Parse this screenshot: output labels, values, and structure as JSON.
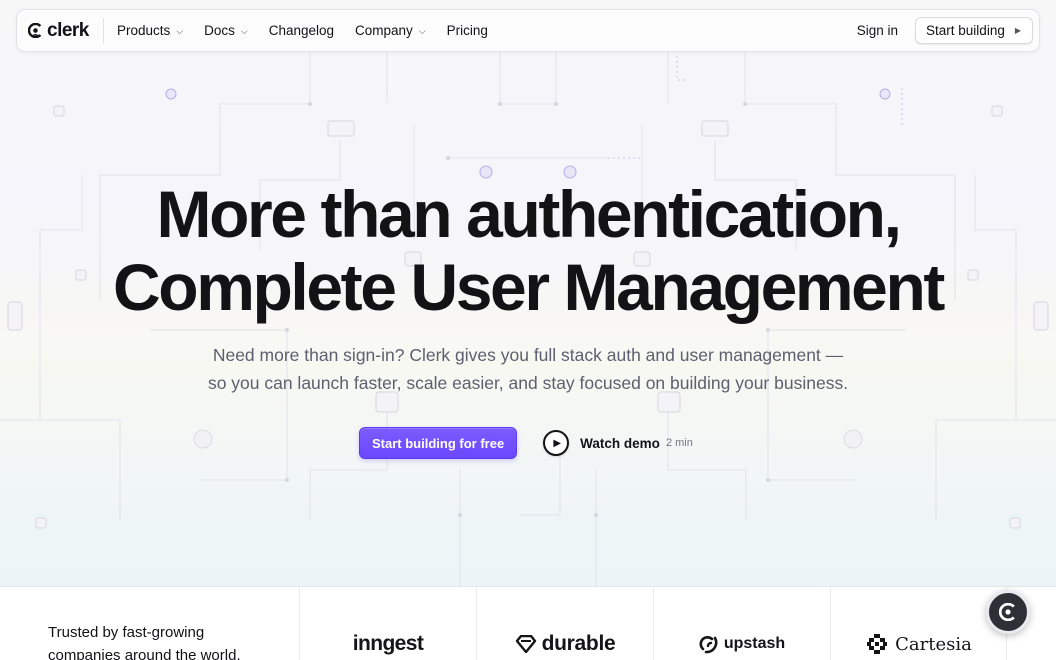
{
  "nav": {
    "logo_text": "clerk",
    "items": [
      {
        "label": "Products",
        "dropdown": true
      },
      {
        "label": "Docs",
        "dropdown": true
      },
      {
        "label": "Changelog",
        "dropdown": false
      },
      {
        "label": "Company",
        "dropdown": true
      },
      {
        "label": "Pricing",
        "dropdown": false
      }
    ],
    "signin_label": "Sign in",
    "start_label": "Start building"
  },
  "hero": {
    "title_line1": "More than authentication,",
    "title_line2": "Complete User Management",
    "subtitle_line1": "Need more than sign-in? Clerk gives you full stack auth and user management —",
    "subtitle_line2": "so you can launch faster, scale easier, and stay focused on building your business.",
    "primary_cta": "Start building for free",
    "demo_label": "Watch demo",
    "demo_duration": "2 min"
  },
  "trust": {
    "text_line1": "Trusted by fast-growing",
    "text_line2": "companies around the world.",
    "brands": [
      "inngest",
      "durable",
      "upstash",
      "Cartesia"
    ]
  },
  "icons": {
    "logo": "clerk-logo-icon",
    "chevron": "chevron-down-icon",
    "play": "play-icon",
    "chat": "chat-launcher-icon"
  },
  "colors": {
    "brand_purple": "#6c47ff",
    "text": "#131316",
    "muted": "#5e5f6e"
  }
}
